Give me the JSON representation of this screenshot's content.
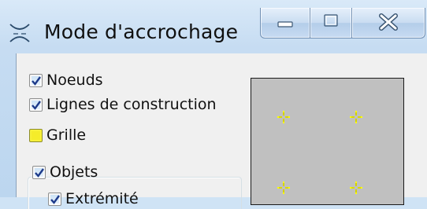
{
  "window": {
    "title": "Mode d'accrochage",
    "icon": "snap-mode-icon",
    "controls": [
      "minimize-icon",
      "maximize-icon",
      "close-icon"
    ]
  },
  "options": {
    "nodes": {
      "label": "Noeuds",
      "checked": true
    },
    "construction_lines": {
      "label": "Lignes de construction",
      "checked": true
    },
    "grid": {
      "label": "Grille",
      "checked": false,
      "highlighted": true
    },
    "objects": {
      "label": "Objets",
      "checked": true
    },
    "extremity": {
      "label": "Extrémité",
      "checked": true
    }
  },
  "preview": {
    "background": "#c0c0c0",
    "marker_color": "#ffff00",
    "marker_icon": "snap-point-icon"
  }
}
